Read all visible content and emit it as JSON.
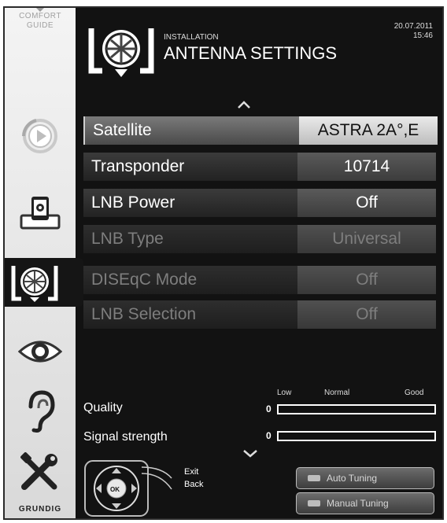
{
  "sidebar": {
    "comfort_guide": "COMFORT\nGUIDE",
    "brand": "GRUNDIG",
    "items": [
      {
        "icon": "source-refresh-icon"
      },
      {
        "icon": "media-device-icon"
      },
      {
        "icon": "satellite-dish-icon",
        "active": true
      },
      {
        "icon": "eye-icon"
      },
      {
        "icon": "ear-icon"
      },
      {
        "icon": "tools-icon"
      }
    ]
  },
  "header": {
    "section": "INSTALLATION",
    "title": "ANTENNA SETTINGS",
    "date": "20.07.2011",
    "time": "15:46"
  },
  "menu": [
    {
      "label": "Satellite",
      "value": "ASTRA 2A°,E",
      "state": "selected"
    },
    {
      "label": "Transponder",
      "value": "10714",
      "state": "enabled"
    },
    {
      "label": "LNB Power",
      "value": "Off",
      "state": "enabled"
    },
    {
      "label": "LNB Type",
      "value": "Universal",
      "state": "disabled"
    },
    {
      "label": "DISEqC Mode",
      "value": "Off",
      "state": "disabled"
    },
    {
      "label": "LNB Selection",
      "value": "Off",
      "state": "disabled"
    }
  ],
  "meters": {
    "scale": {
      "low": "Low",
      "normal": "Normal",
      "good": "Good"
    },
    "quality": {
      "label": "Quality",
      "value": "0",
      "level": 0
    },
    "signal": {
      "label": "Signal strength",
      "value": "0",
      "level": 0
    }
  },
  "nav": {
    "ok": "OK",
    "exit": "Exit",
    "back": "Back"
  },
  "buttons": {
    "auto_tuning": "Auto Tuning",
    "manual_tuning": "Manual Tuning"
  },
  "colors": {
    "background": "#121212",
    "sidebar": "#e6e6e6",
    "selected_value": "#d9d9d9"
  }
}
